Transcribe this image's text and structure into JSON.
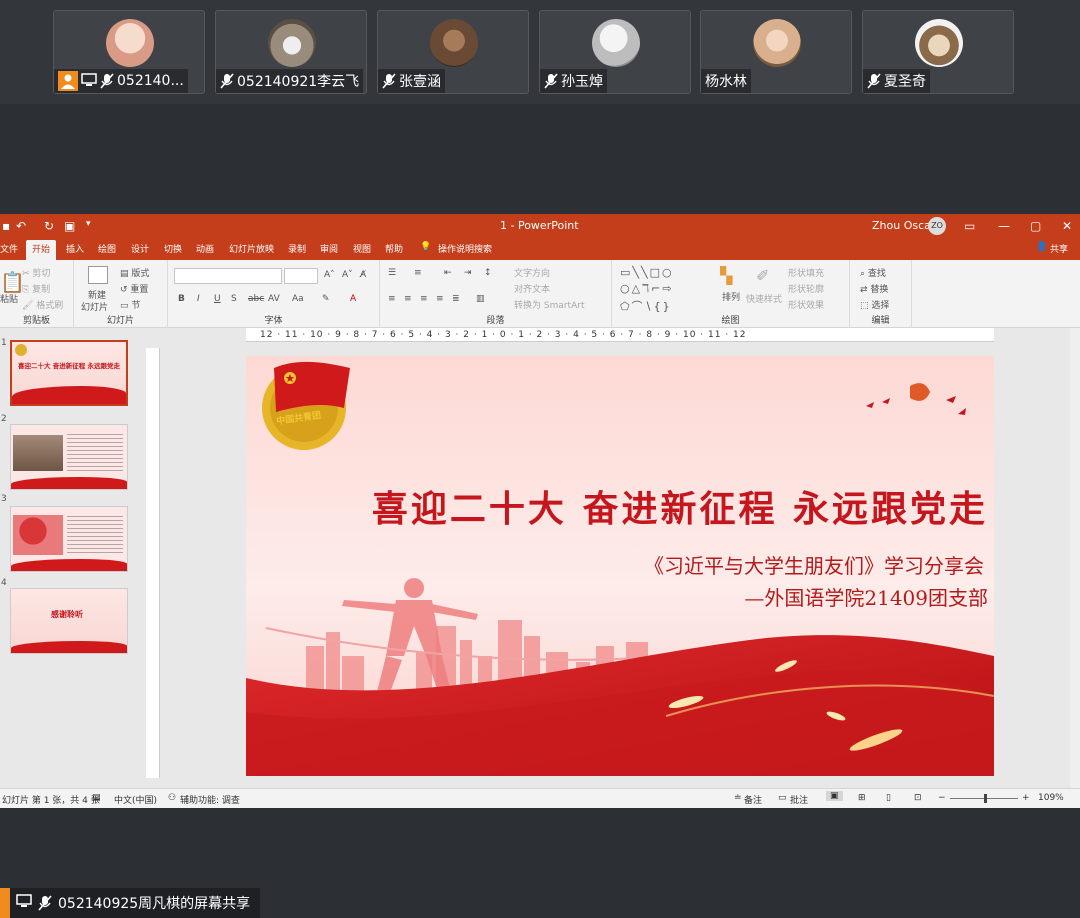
{
  "participants": [
    {
      "name": "052140...",
      "host": true,
      "color": "#e8b9a8"
    },
    {
      "name": "052140921李云飞",
      "host": false,
      "color": "#9a8c7c"
    },
    {
      "name": "张壹涵",
      "host": false,
      "color": "#6b4a35"
    },
    {
      "name": "孙玉焯",
      "host": false,
      "color": "#c9c9c9"
    },
    {
      "name": "杨水林",
      "host": false,
      "color": "#d8b08e"
    },
    {
      "name": "夏圣奇",
      "host": false,
      "color": "#c8b69a"
    }
  ],
  "ppt": {
    "window_title": "1  -  PowerPoint",
    "user_name": "Zhou Oscar",
    "user_initials": "ZO",
    "tabs": [
      "文件",
      "开始",
      "插入",
      "绘图",
      "设计",
      "切换",
      "动画",
      "幻灯片放映",
      "录制",
      "审阅",
      "视图",
      "帮助",
      "操作说明搜索"
    ],
    "share_label": "共享",
    "ribbon": {
      "clipboard": {
        "label": "剪贴板",
        "paste": "粘贴",
        "cut": "剪切",
        "copy": "复制",
        "format_painter": "格式刷"
      },
      "slides": {
        "label": "幻灯片",
        "new_slide": "新建",
        "new_slide2": "幻灯片",
        "layout": "版式",
        "reset": "重置",
        "section": "节"
      },
      "font": {
        "label": "字体"
      },
      "paragraph": {
        "label": "段落",
        "text_direction": "文字方向",
        "align_text": "对齐文本",
        "smartart": "转换为 SmartArt"
      },
      "drawing": {
        "label": "绘图",
        "arrange": "排列",
        "quick_styles": "快速样式",
        "shape_fill": "形状填充",
        "shape_outline": "形状轮廓",
        "shape_effects": "形状效果"
      },
      "editing": {
        "label": "编辑",
        "find": "查找",
        "replace": "替换",
        "select": "选择"
      }
    },
    "ruler_text": "12 · 11 · 10 · 9 · 8 · 7 · 6 · 5 · 4 · 3 · 2 · 1 · 0 · 1 · 2 · 3 · 4 · 5 · 6 · 7 · 8 · 9 · 10 · 11 · 12",
    "thumbnails": [
      {
        "num": "1",
        "caption": "喜迎二十大 奋进新征程 永远跟党走"
      },
      {
        "num": "2",
        "caption": ""
      },
      {
        "num": "3",
        "caption": ""
      },
      {
        "num": "4",
        "caption": "感谢聆听"
      }
    ],
    "slide": {
      "title": "喜迎二十大 奋进新征程 永远跟党走",
      "subtitle1": "《习近平与大学生朋友们》学习分享会",
      "subtitle2": "—外国语学院21409团支部",
      "emblem_text": "中国共青团"
    },
    "status": {
      "slide_info": "幻灯片 第 1 张，共 4 张",
      "language": "中文(中国)",
      "accessibility": "辅助功能: 调查",
      "notes": "备注",
      "comments": "批注",
      "zoom": "109%"
    }
  },
  "share": {
    "label": "052140925周凡棋的屏幕共享"
  },
  "colors": {
    "accent": "#c43e1c",
    "slide_red": "#d0191b",
    "host_orange": "#f08c1e"
  }
}
